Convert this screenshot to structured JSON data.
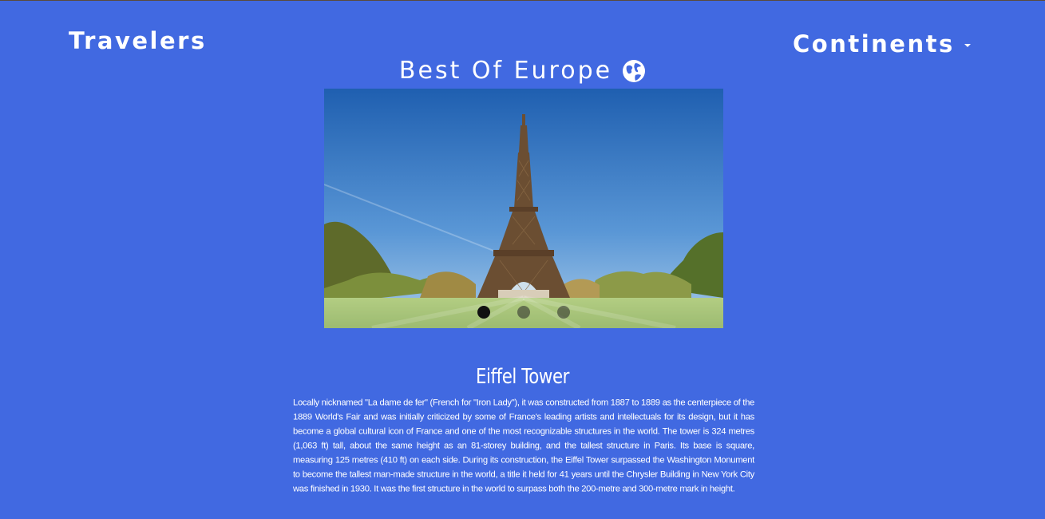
{
  "nav": {
    "brand": "Travelers",
    "dropdown_label": "Continents"
  },
  "hero": {
    "title": "Best Of Europe",
    "title_icon": "globe-icon"
  },
  "carousel": {
    "slide_count": 3,
    "active_index": 0,
    "current_image": "eiffel-tower-photo"
  },
  "article": {
    "title": "Eiffel Tower",
    "body": "Locally nicknamed \"La dame de fer\" (French for \"Iron Lady\"), it was constructed from 1887 to 1889 as the centerpiece of the 1889 World's Fair and was initially criticized by some of France's leading artists and intellectuals for its design, but it has become a global cultural icon of France and one of the most recognizable structures in the world. The tower is 324 metres (1,063 ft) tall, about the same height as an 81-storey building, and the tallest structure in Paris. Its base is square, measuring 125 metres (410 ft) on each side. During its construction, the Eiffel Tower surpassed the Washington Monument to become the tallest man-made structure in the world, a title it held for 41 years until the Chrysler Building in New York City was finished in 1930. It was the first structure in the world to surpass both the 200-metre and 300-metre mark in height."
  },
  "colors": {
    "background": "#4169e1",
    "text": "#ffffff",
    "dot_active": "#111111"
  }
}
